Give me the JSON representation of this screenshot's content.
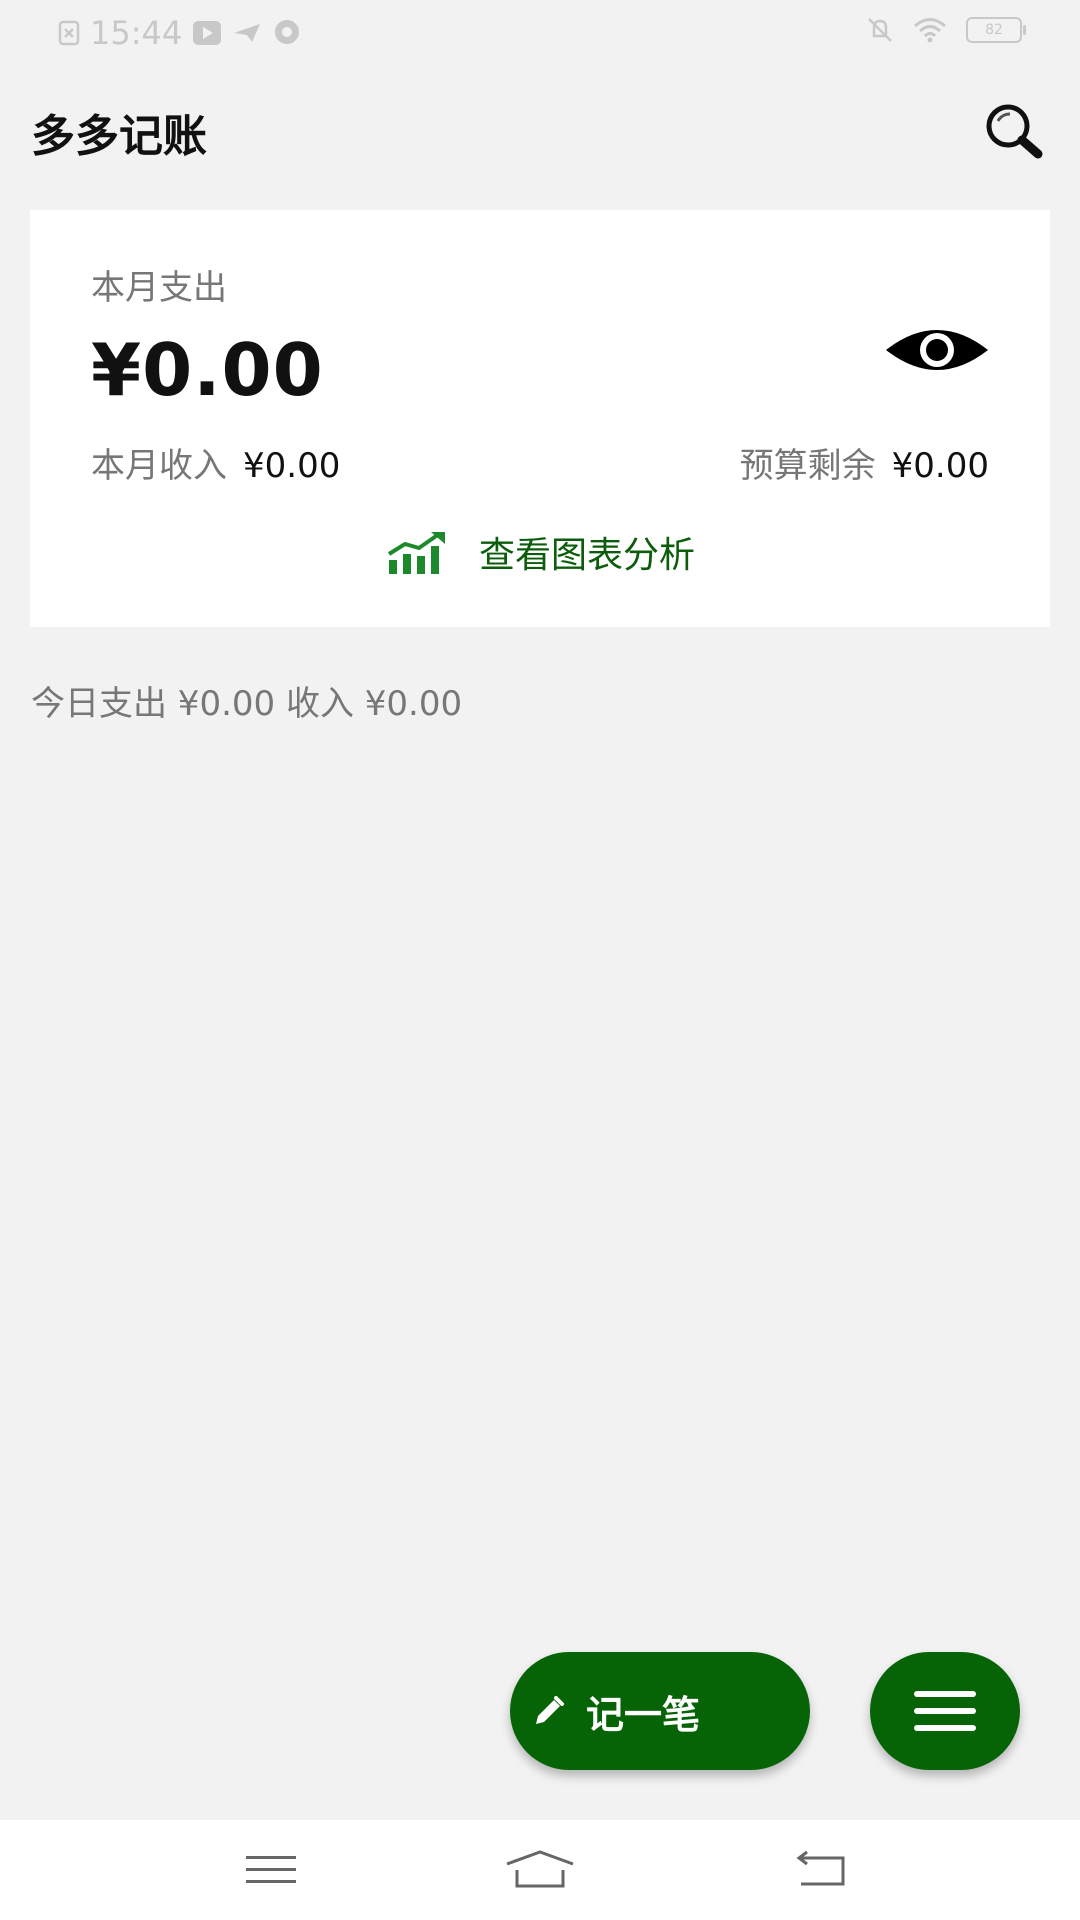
{
  "status_bar": {
    "time": "15:44",
    "battery": "82"
  },
  "header": {
    "title": "多多记账"
  },
  "summary": {
    "month_expense_label": "本月支出",
    "month_expense_value": "¥0.00",
    "month_income_label": "本月收入",
    "month_income_value": "¥0.00",
    "budget_remaining_label": "预算剩余",
    "budget_remaining_value": "¥0.00",
    "chart_link_label": "查看图表分析"
  },
  "today": {
    "text": "今日支出 ¥0.00 收入 ¥0.00"
  },
  "actions": {
    "record_label": "记一笔"
  },
  "icons": {
    "search": "search-icon",
    "eye": "eye-icon",
    "chart": "bar-chart-trend-icon",
    "pencil": "pencil-icon",
    "menu": "menu-icon"
  },
  "colors": {
    "accent": "#066406",
    "chart_link": "#0b5d0b",
    "background": "#f2f2f2",
    "card": "#ffffff"
  }
}
